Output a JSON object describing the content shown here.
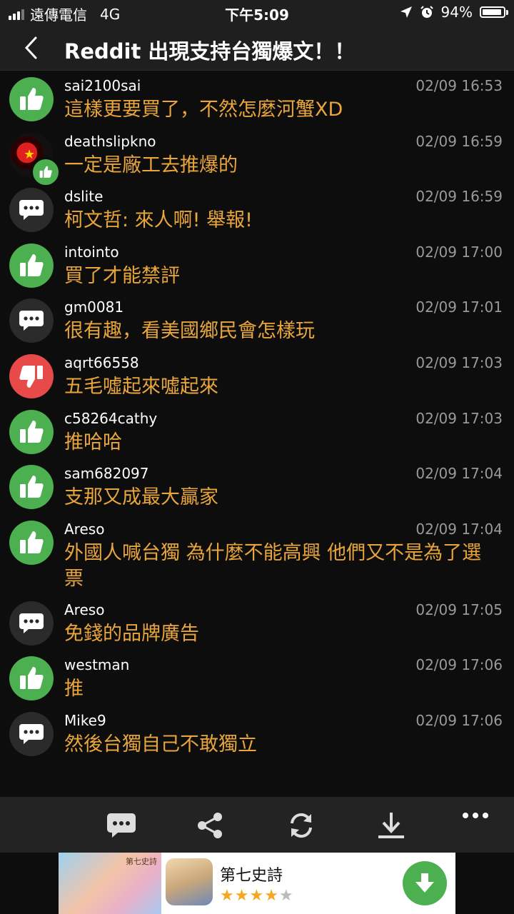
{
  "status": {
    "carrier": "遠傳電信",
    "network": "4G",
    "time": "下午5:09",
    "battery": "94%",
    "battery_level": 0.94
  },
  "nav": {
    "title": "Reddit 出現支持台獨爆文！！"
  },
  "comments": [
    {
      "user": "sai2100sai",
      "time": "02/09 16:53",
      "text": "這樣更要買了，不然怎麼河蟹XD",
      "type": "up"
    },
    {
      "user": "deathslipkno",
      "time": "02/09 16:59",
      "text": "一定是廠工去推爆的",
      "type": "photo-up"
    },
    {
      "user": "dslite",
      "time": "02/09 16:59",
      "text": "柯文哲: 來人啊! 舉報!",
      "type": "chat"
    },
    {
      "user": "intointo",
      "time": "02/09 17:00",
      "text": "買了才能禁評",
      "type": "up"
    },
    {
      "user": "gm0081",
      "time": "02/09 17:01",
      "text": "很有趣，看美國鄉民會怎樣玩",
      "type": "chat"
    },
    {
      "user": "aqrt66558",
      "time": "02/09 17:03",
      "text": "五毛噓起來噓起來",
      "type": "down"
    },
    {
      "user": "c58264cathy",
      "time": "02/09 17:03",
      "text": "推哈哈",
      "type": "up"
    },
    {
      "user": "sam682097",
      "time": "02/09 17:04",
      "text": "支那又成最大贏家",
      "type": "up"
    },
    {
      "user": "Areso",
      "time": "02/09 17:04",
      "text": "外國人喊台獨 為什麼不能高興 他們又不是為了選票",
      "type": "up"
    },
    {
      "user": "Areso",
      "time": "02/09 17:05",
      "text": "免錢的品牌廣告",
      "type": "chat"
    },
    {
      "user": "westman",
      "time": "02/09 17:06",
      "text": "推",
      "type": "up"
    },
    {
      "user": "Mike9",
      "time": "02/09 17:06",
      "text": "然後台獨自己不敢獨立",
      "type": "chat"
    }
  ],
  "toolbar": {
    "icons": [
      "comment-icon",
      "share-icon",
      "refresh-icon",
      "download-icon",
      "more-icon"
    ]
  },
  "ad": {
    "title": "第七史詩",
    "banner_text": "第七史詩",
    "rating": 4.5,
    "accent": "#4caf50"
  },
  "colors": {
    "up": "#4caf50",
    "down": "#e84a4a",
    "comment_text": "#e8a53c",
    "time": "#9a9a9a"
  }
}
